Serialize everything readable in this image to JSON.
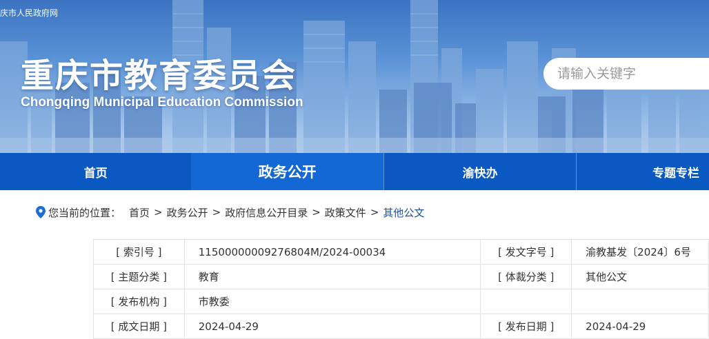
{
  "header": {
    "top_link": "庆市人民政府网",
    "title": "重庆市教育委员会",
    "subtitle": "Chongqing Municipal Education Commission",
    "search_placeholder": "请输入关键字"
  },
  "nav": {
    "items": [
      {
        "label": "首页"
      },
      {
        "label": "政务公开",
        "active": true
      },
      {
        "label": "渝快办"
      },
      {
        "label": "专题专栏"
      }
    ]
  },
  "breadcrumb": {
    "label": "您当前的位置：",
    "items": [
      "首页",
      "政务公开",
      "政府信息公开目录",
      "政策文件",
      "其他公文"
    ],
    "separator": ">"
  },
  "info": {
    "rows": [
      {
        "l1": "[ 索引号 ]",
        "v1": "11500000009276804M/2024-00034",
        "l2": "[ 发文字号 ]",
        "v2": "渝教基发〔2024〕6号"
      },
      {
        "l1": "[ 主题分类 ]",
        "v1": "教育",
        "l2": "[ 体裁分类 ]",
        "v2": "其他公文"
      },
      {
        "l1": "[ 发布机构 ]",
        "v1": "市教委",
        "l2": "",
        "v2": ""
      },
      {
        "l1": "[ 成文日期 ]",
        "v1": "2024-04-29",
        "l2": "[ 发布日期 ]",
        "v2": "2024-04-29"
      }
    ]
  },
  "colors": {
    "nav_bg": "#0a58c2",
    "nav_active": "#1468d6",
    "breadcrumb_current": "#1a4fa3",
    "pin": "#1a6fd6"
  }
}
